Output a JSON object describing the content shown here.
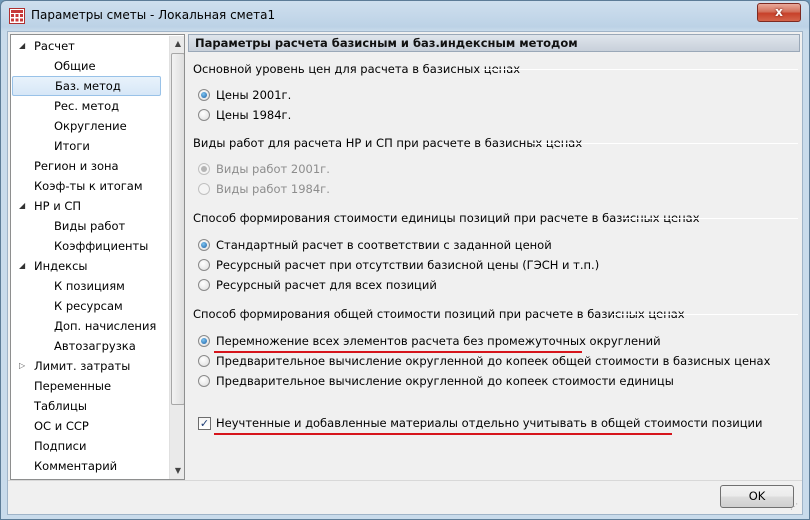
{
  "window": {
    "title": "Параметры сметы - Локальная смета1",
    "close_label": "x"
  },
  "tree": {
    "items": [
      {
        "label": "Расчет",
        "level": 0,
        "expander": "open"
      },
      {
        "label": "Общие",
        "level": 1
      },
      {
        "label": "Баз. метод",
        "level": 1,
        "selected": true
      },
      {
        "label": "Рес. метод",
        "level": 1
      },
      {
        "label": "Округление",
        "level": 1
      },
      {
        "label": "Итоги",
        "level": 1
      },
      {
        "label": "Регион и зона",
        "level": 0
      },
      {
        "label": "Коэф-ты к итогам",
        "level": 0
      },
      {
        "label": "НР и СП",
        "level": 0,
        "expander": "open"
      },
      {
        "label": "Виды работ",
        "level": 1
      },
      {
        "label": "Коэффициенты",
        "level": 1
      },
      {
        "label": "Индексы",
        "level": 0,
        "expander": "open"
      },
      {
        "label": "К позициям",
        "level": 1
      },
      {
        "label": "К ресурсам",
        "level": 1
      },
      {
        "label": "Доп. начисления",
        "level": 1
      },
      {
        "label": "Автозагрузка",
        "level": 1
      },
      {
        "label": "Лимит. затраты",
        "level": 0,
        "expander": "closed"
      },
      {
        "label": "Переменные",
        "level": 0
      },
      {
        "label": "Таблицы",
        "level": 0
      },
      {
        "label": "ОС и ССР",
        "level": 0
      },
      {
        "label": "Подписи",
        "level": 0
      },
      {
        "label": "Комментарий",
        "level": 0
      }
    ]
  },
  "panel": {
    "header": "Параметры расчета базисным и баз.индексным методом",
    "groups": [
      {
        "title": "Основной уровень цен для расчета в базисных ценах",
        "options": [
          {
            "label": "Цены 2001г.",
            "checked": true
          },
          {
            "label": "Цены 1984г.",
            "checked": false
          }
        ]
      },
      {
        "title": "Виды работ для расчета НР и СП при расчете в базисных ценах",
        "options": [
          {
            "label": "Виды работ 2001г.",
            "checked": true,
            "disabled": true
          },
          {
            "label": "Виды работ 1984г.",
            "checked": false,
            "disabled": true
          }
        ]
      },
      {
        "title": "Способ формирования стоимости единицы позиций при расчете в базисных ценах",
        "options": [
          {
            "label": "Стандартный расчет в соответствии с заданной ценой",
            "checked": true
          },
          {
            "label": "Ресурсный расчет при отсутствии базисной цены (ГЭСН и т.п.)",
            "checked": false
          },
          {
            "label": "Ресурсный расчет для всех позиций",
            "checked": false
          }
        ]
      },
      {
        "title": "Способ формирования общей стоимости позиций при расчете в базисных ценах",
        "options": [
          {
            "label": "Перемножение всех элементов расчета без промежуточных округлений",
            "checked": true
          },
          {
            "label": "Предварительное вычисление округленной до копеек общей стоимости в базисных ценах",
            "checked": false
          },
          {
            "label": "Предварительное вычисление округленной до копеек стоимости единицы",
            "checked": false
          }
        ]
      }
    ],
    "checkbox": {
      "label": "Неучтенные и добавленные материалы отдельно учитывать в общей стоимости позиции",
      "checked": true,
      "mark": "✓"
    }
  },
  "buttons": {
    "ok": "OK"
  },
  "colors": {
    "highlight_underline": "#d6141b",
    "selection": "#d7e7f7"
  }
}
